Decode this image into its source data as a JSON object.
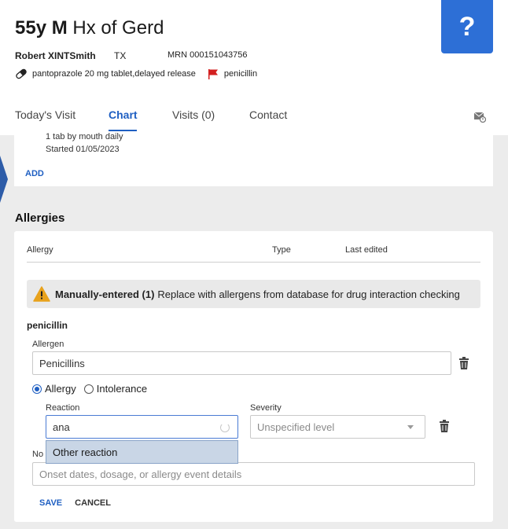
{
  "header": {
    "title_age_sex": "55y M",
    "title_history": "Hx of Gerd",
    "help_label": "?",
    "patient_name": "Robert XINTSmith",
    "patient_state": "TX",
    "mrn": "MRN 000151043756",
    "medication": "pantoprazole 20 mg tablet,delayed release",
    "allergy_flag": "penicillin",
    "pill_icon": "pill-icon",
    "flag_icon": "red-flag-icon",
    "flag_color": "#d32020"
  },
  "tabs": [
    {
      "label": "Today's Visit",
      "active": false
    },
    {
      "label": "Chart",
      "active": true
    },
    {
      "label": "Visits (0)",
      "active": false
    },
    {
      "label": "Contact",
      "active": false
    }
  ],
  "medication_card": {
    "sig": "1 tab by mouth daily",
    "started": "Started 01/05/2023",
    "add_label": "ADD"
  },
  "allergies": {
    "section_title": "Allergies",
    "columns": [
      "Allergy",
      "Type",
      "Last edited"
    ],
    "warning_bold": "Manually-entered (1)",
    "warning_text": "Replace with allergens from database for drug interaction checking",
    "warning_color": "#e8a21c",
    "entry_name": "penicillin",
    "allergen_label": "Allergen",
    "allergen_value": "Penicillins",
    "radio_allergy": "Allergy",
    "radio_intolerance": "Intolerance",
    "selected_type": "Allergy",
    "reaction_label": "Reaction",
    "reaction_value": "ana",
    "severity_label": "Severity",
    "severity_placeholder": "Unspecified level",
    "dropdown_option": "Other reaction",
    "note_label_prefix": "No",
    "note_placeholder": "Onset dates, dosage, or allergy event details",
    "save_label": "SAVE",
    "cancel_label": "CANCEL"
  },
  "accent_color": "#1f5fc2",
  "help_color": "#2d6fd6"
}
